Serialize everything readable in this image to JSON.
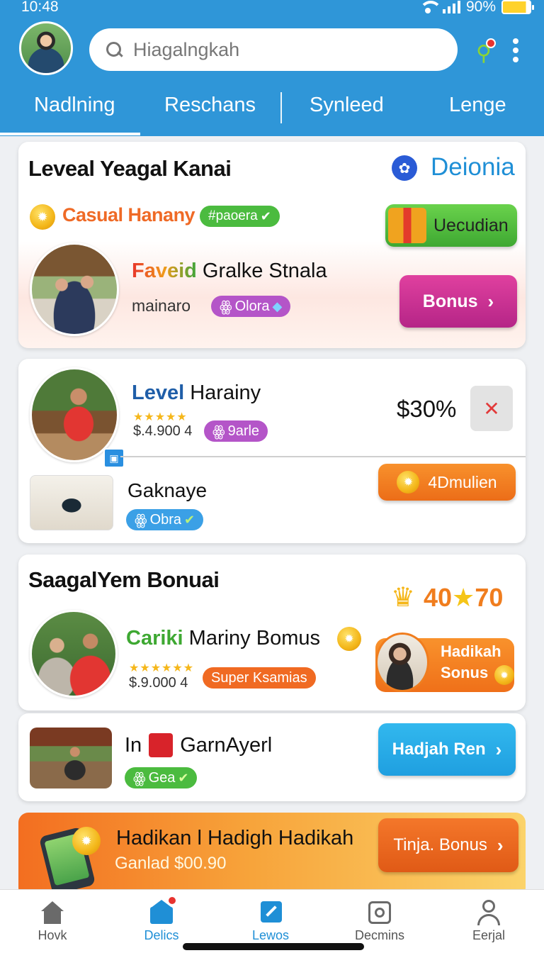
{
  "status": {
    "time": "10:48",
    "battery": "90%"
  },
  "search": {
    "placeholder": "Hiagalngkah"
  },
  "tabs": [
    "Nadlning",
    "Reschans",
    "Synleed",
    "Lenge"
  ],
  "card1": {
    "title": "Leveal Yeagal Kanai",
    "corner_label": "Deionia",
    "casual_label": "Casual Hanany",
    "casual_tag": "#paoera",
    "gift_button": "Uecudian",
    "game_title_colored": "Faveid",
    "game_title": " Gralke Stnala",
    "game_sub": "mainaro",
    "game_tag": "Olora",
    "bonus_button": "Bonus"
  },
  "card2": {
    "title_blue": "Level",
    "title": " Harainy",
    "rating": "$.4.900  4",
    "tag": "9arle",
    "percent": "$30%",
    "sub_title": "Gaknaye",
    "sub_tag": "Obra",
    "reward_button": "4Dmulien"
  },
  "card3": {
    "title": "SaagalYem Bonuai",
    "score": "40",
    "score2": "70",
    "game_title_green": "Cariki",
    "game_title": " Mariny Bomus",
    "rating": "$.9.000  4",
    "tag": "Super Ksamias",
    "promo_line1": "Hadikah",
    "promo_line2": "Sonus"
  },
  "card4": {
    "title_pre": "In",
    "title": "GarnAyerl",
    "tag": "Gea",
    "button": "Hadjah Ren"
  },
  "banner": {
    "title": "Hadikan l Hadigh Hadikah",
    "sub": "Ganlad $00.90",
    "button": "Tinja. Bonus"
  },
  "nav": [
    {
      "label": "Hovk",
      "icon": "home-icon"
    },
    {
      "label": "Delics",
      "icon": "store-icon"
    },
    {
      "label": "Lewos",
      "icon": "send-icon"
    },
    {
      "label": "Decmins",
      "icon": "settings-icon"
    },
    {
      "label": "Eerjal",
      "icon": "profile-icon"
    }
  ],
  "colors": {
    "header": "#2f96d8",
    "accent_green": "#49b93b",
    "accent_magenta": "#c02c8f",
    "accent_orange": "#f07d1e",
    "accent_cyan": "#24aee8"
  }
}
